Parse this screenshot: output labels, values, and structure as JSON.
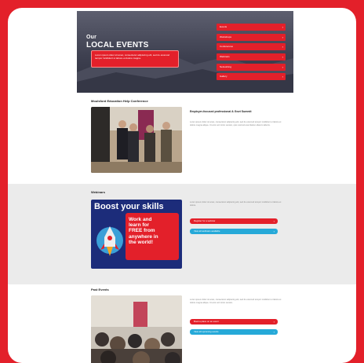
{
  "hero": {
    "title_line1": "Our",
    "title_line2": "LOCAL EVENTS",
    "banner_text": "Lorem ipsum dolor sit amet, consectetur adipiscing elit, sed do eiusmod tempor incididunt ut labore et dolore magna.",
    "menu": [
      {
        "label": "Events"
      },
      {
        "label": "Workshops"
      },
      {
        "label": "Conferences"
      },
      {
        "label": "Webinars"
      },
      {
        "label": "Networking"
      },
      {
        "label": "Gallery"
      }
    ]
  },
  "section1": {
    "title": "Moulsford Education Help Conference",
    "heading": "Employer-focused professional & Govt Summit",
    "text": "Lorem ipsum dolor sit amet, consectetur adipiscing elit, sed do eiusmod tempor incididunt ut labore et dolore magna aliqua. Ut enim ad minim veniam, quis nostrud exercitation ullamco laboris."
  },
  "section2": {
    "title": "Webinars",
    "skills_title": "Boost your skills",
    "skills_lines": [
      "Work and",
      "learn for",
      "FREE from",
      "anywhere in",
      "the world!"
    ],
    "text": "Lorem ipsum dolor sit amet, consectetur adipiscing elit, sed do eiusmod tempor incididunt ut labore et dolore.",
    "btn_red": "Register for a webinar",
    "btn_blue": "View all webinars available"
  },
  "section3": {
    "title": "Past Events",
    "text": "Lorem ipsum dolor sit amet, consectetur adipiscing elit, sed do eiusmod tempor incididunt ut labore et dolore magna aliqua. Ut enim ad minim veniam.",
    "btn_red": "Book a place on an event",
    "btn_blue": "View all upcoming events"
  },
  "colors": {
    "accent": "#e3202a",
    "blue": "#26a9d8",
    "navy": "#1c2c7a",
    "band": "#ebebeb"
  }
}
